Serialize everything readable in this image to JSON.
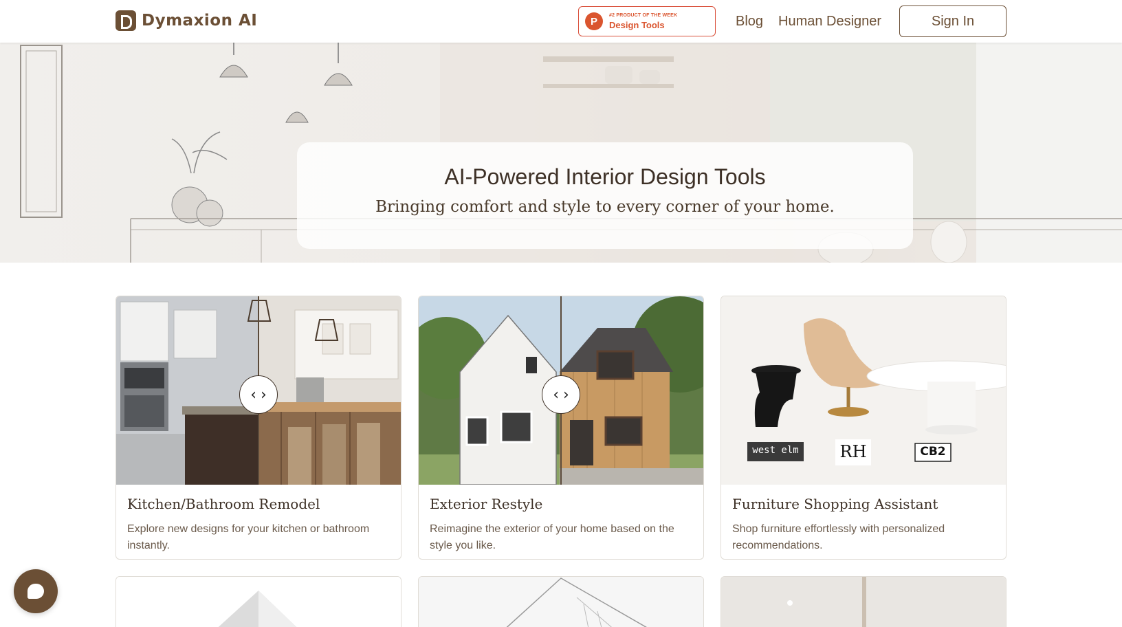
{
  "header": {
    "logo_text": "Dymaxion AI",
    "product_hunt": {
      "small": "#2 PRODUCT OF THE WEEK",
      "big": "Design Tools",
      "letter": "P"
    },
    "nav": {
      "blog": "Blog",
      "human_designer": "Human Designer",
      "sign_in": "Sign In"
    }
  },
  "hero": {
    "title": "AI-Powered Interior Design Tools",
    "subtitle": "Bringing comfort and style to every corner of your home."
  },
  "cards": [
    {
      "title": "Kitchen/Bathroom Remodel",
      "description": "Explore new designs for your kitchen or bathroom instantly."
    },
    {
      "title": "Exterior Restyle",
      "description": "Reimagine the exterior of your home based on the style you like."
    },
    {
      "title": "Furniture Shopping Assistant",
      "description": "Shop furniture effortlessly with personalized recommendations."
    }
  ],
  "brands": {
    "west_elm": "west elm",
    "rh": "RH",
    "cb2": "CB2"
  },
  "slider": {
    "left": "‹",
    "right": "›"
  },
  "colors": {
    "brand": "#6b4f35",
    "product_hunt": "#da552f"
  }
}
